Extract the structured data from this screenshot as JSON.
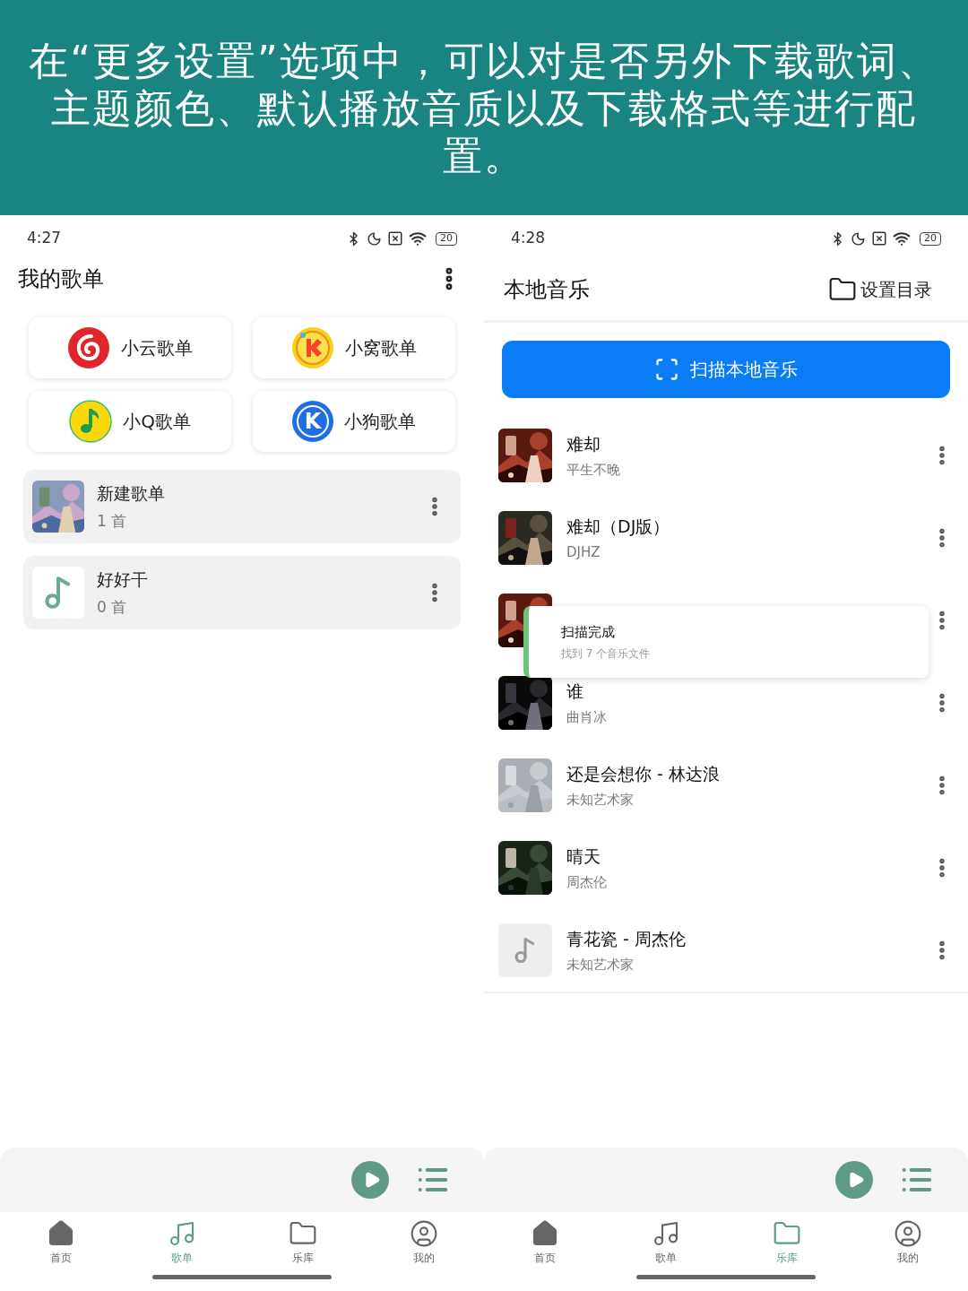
{
  "banner": {
    "text": "在“更多设置”选项中，可以对是否另外下载歌词、主题颜色、默认播放音质以及下载格式等进行配置。"
  },
  "screens": [
    {
      "kind": "playlists",
      "status_bar": {
        "time": "4:27",
        "battery": "20"
      },
      "title": "我的歌单",
      "sources": [
        {
          "label": "小云歌单",
          "kind": "cloud"
        },
        {
          "label": "小窝歌单",
          "kind": "nest"
        },
        {
          "label": "小Q歌单",
          "kind": "q"
        },
        {
          "label": "小狗歌单",
          "kind": "dog",
          "logo_text": "K"
        }
      ],
      "playlists": [
        {
          "name": "新建歌单",
          "count": "1 首",
          "kind": "picture"
        },
        {
          "name": "好好干",
          "count": "0 首",
          "kind": "note"
        }
      ],
      "nav": [
        {
          "label": "首页",
          "kind": "home",
          "selected": false
        },
        {
          "label": "歌单",
          "kind": "music",
          "selected": true
        },
        {
          "label": "乐库",
          "kind": "folder",
          "selected": false
        },
        {
          "label": "我的",
          "kind": "user",
          "selected": false
        }
      ]
    },
    {
      "kind": "local",
      "status_bar": {
        "time": "4:28",
        "battery": "20"
      },
      "title": "本地音乐",
      "action": "设置目录",
      "scan_button": "扫描本地音乐",
      "songs": [
        {
          "title": "难却",
          "artist": "平生不晚",
          "kind": "picture"
        },
        {
          "title": "难却（DJ版）",
          "artist": "DJHZ",
          "kind": "picture"
        },
        {
          "kind": "picture"
        },
        {
          "title": "谁",
          "artist": "曲肖冰",
          "kind": "picture"
        },
        {
          "title": "还是会想你 - 林达浪",
          "artist": "未知艺术家",
          "kind": "picture"
        },
        {
          "title": "晴天",
          "artist": "周杰伦",
          "kind": "picture"
        },
        {
          "title": "青花瓷 - 周杰伦",
          "artist": "未知艺术家",
          "kind": "placeholder"
        }
      ],
      "toast": {
        "title": "扫描完成",
        "message": "找到 7 个音乐文件"
      },
      "nav": [
        {
          "label": "首页",
          "kind": "home",
          "selected": false
        },
        {
          "label": "歌单",
          "kind": "music",
          "selected": false
        },
        {
          "label": "乐库",
          "kind": "folder",
          "selected": true
        },
        {
          "label": "我的",
          "kind": "user",
          "selected": false
        }
      ]
    }
  ]
}
